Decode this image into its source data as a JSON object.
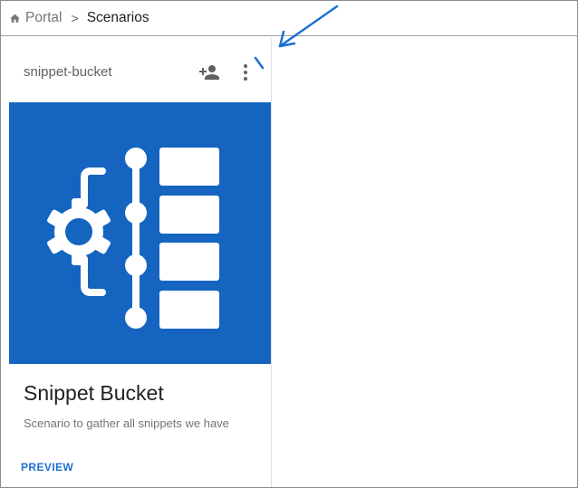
{
  "breadcrumb": {
    "home_label": "Portal",
    "separator": ">",
    "current_label": "Scenarios"
  },
  "card": {
    "header_title": "snippet-bucket",
    "title": "Snippet Bucket",
    "subtitle": "Scenario to gather all snippets we have",
    "action_label": "PREVIEW",
    "media_color": "#1565c0"
  },
  "icons": {
    "home": "home-icon",
    "add_user": "person-add-icon",
    "more": "more-vert-icon",
    "media": "snippet-bucket-illustration"
  },
  "colors": {
    "accent": "#1e6fd1",
    "annotation": "#1e6fd1"
  }
}
